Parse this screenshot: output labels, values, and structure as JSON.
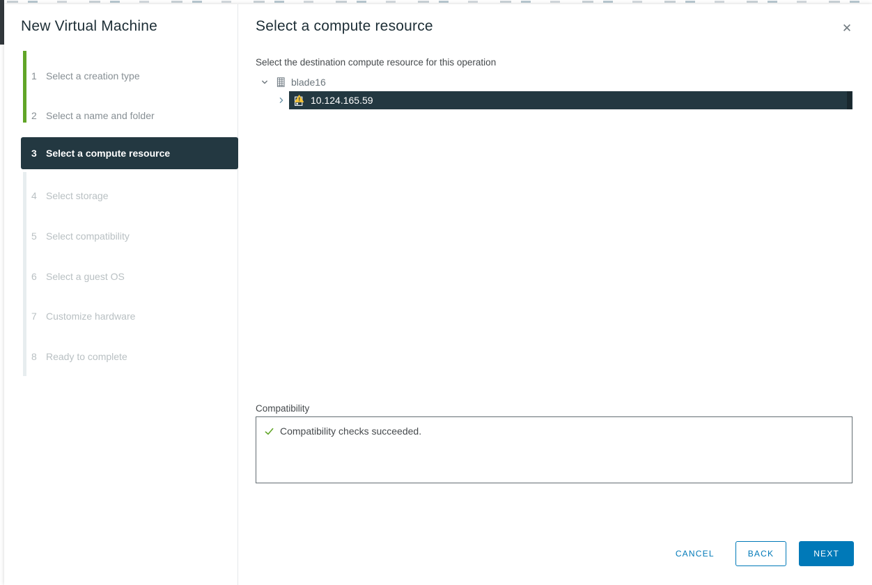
{
  "wizard": {
    "title": "New Virtual Machine",
    "steps": [
      {
        "num": "1",
        "label": "Select a creation type",
        "state": "completed"
      },
      {
        "num": "2",
        "label": "Select a name and folder",
        "state": "completed"
      },
      {
        "num": "3",
        "label": "Select a compute resource",
        "state": "active"
      },
      {
        "num": "4",
        "label": "Select storage",
        "state": "upcoming"
      },
      {
        "num": "5",
        "label": "Select compatibility",
        "state": "upcoming"
      },
      {
        "num": "6",
        "label": "Select a guest OS",
        "state": "upcoming"
      },
      {
        "num": "7",
        "label": "Customize hardware",
        "state": "upcoming"
      },
      {
        "num": "8",
        "label": "Ready to complete",
        "state": "upcoming"
      }
    ]
  },
  "page": {
    "title": "Select a compute resource",
    "instruction": "Select the destination compute resource for this operation"
  },
  "tree": {
    "datacenter": {
      "label": "blade16",
      "icon": "datacenter-icon",
      "expanded": true
    },
    "host": {
      "label": "10.124.165.59",
      "icon": "host-warning-icon",
      "selected": true
    }
  },
  "compatibility": {
    "label": "Compatibility",
    "message": "Compatibility checks succeeded.",
    "status_icon": "check-icon"
  },
  "footer": {
    "cancel": "CANCEL",
    "back": "BACK",
    "next": "NEXT"
  },
  "icons": {
    "close": "✕"
  },
  "colors": {
    "accent_blue": "#0079b8",
    "active_dark": "#233841",
    "progress_green": "#61a527",
    "success_green": "#61a527",
    "warning_yellow": "#f5c338",
    "heading": "#1d2e36"
  }
}
